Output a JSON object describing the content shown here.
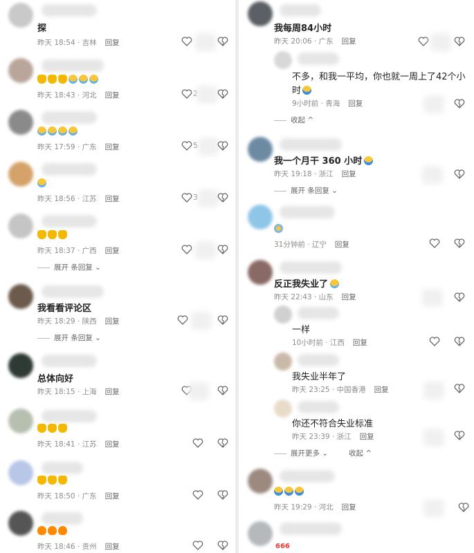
{
  "left": [
    {
      "text": "探",
      "emojis": [],
      "date": "昨天 18:54",
      "loc": "吉林",
      "reply": "回复",
      "likes": "",
      "av": "#c9c9c9"
    },
    {
      "text": "",
      "emojis": [
        "thumb",
        "thumb",
        "thumb",
        "cry",
        "cry",
        "cry"
      ],
      "date": "昨天 18:43",
      "loc": "河北",
      "reply": "回复",
      "likes": "2",
      "av": "#b9a59a"
    },
    {
      "text": "",
      "emojis": [
        "cry",
        "cry",
        "cry",
        "cry"
      ],
      "date": "昨天 17:59",
      "loc": "广东",
      "reply": "回复",
      "likes": "5",
      "av": "#8a8a8a"
    },
    {
      "text": "",
      "emojis": [
        "cry"
      ],
      "date": "昨天 18:56",
      "loc": "江苏",
      "reply": "回复",
      "likes": "3",
      "av": "#d5a36a"
    },
    {
      "text": "",
      "emojis": [
        "thumb",
        "thumb",
        "thumb"
      ],
      "date": "昨天 18:37",
      "loc": "广西",
      "reply": "回复",
      "likes": "",
      "av": "#c5c5c5",
      "expand": "展开 条回复"
    },
    {
      "text": "我看看评论区",
      "emojis": [],
      "date": "昨天 18:29",
      "loc": "陕西",
      "reply": "回复",
      "likes": "",
      "av": "#6c5a4c",
      "expand": "展开 条回复"
    },
    {
      "text": "总体向好",
      "emojis": [],
      "date": "昨天 18:15",
      "loc": "上海",
      "reply": "回复",
      "likes": "",
      "av": "#2e3a33"
    },
    {
      "text": "",
      "emojis": [
        "thumb",
        "thumb",
        "thumb"
      ],
      "date": "昨天 18:41",
      "loc": "江苏",
      "reply": "回复",
      "likes": "",
      "av": "#b7c0b0"
    },
    {
      "text": "",
      "emojis": [
        "thumb",
        "thumb",
        "thumb"
      ],
      "date": "昨天 18:50",
      "loc": "广东",
      "reply": "回复",
      "likes": "",
      "av": "#b8c6e8"
    },
    {
      "text": "",
      "emojis": [
        "fire",
        "fire",
        "fire"
      ],
      "date": "昨天 18:46",
      "loc": "贵州",
      "reply": "回复",
      "likes": "",
      "av": "#555555"
    }
  ],
  "right": {
    "c1": {
      "text": "我每周84小时",
      "date": "昨天 20:06",
      "loc": "广东",
      "reply": "回复",
      "av": "#5b5f66"
    },
    "c1r": {
      "text": "不多，和我一平均，你也就一周上了42个小",
      "text2": "时",
      "date": "9小时前",
      "loc": "青海",
      "reply": "回复",
      "av": "#d8d8d8"
    },
    "collapse1": "收起",
    "c2": {
      "text": "我一个月干 360 小时",
      "date": "昨天 19:18",
      "loc": "浙江",
      "reply": "回复",
      "av": "#6d8aa3",
      "expand": "展开 条回复"
    },
    "c3": {
      "text": "",
      "date": "31分钟前",
      "loc": "辽宁",
      "reply": "回复",
      "av": "#8fc6e8"
    },
    "c4": {
      "text": "反正我失业了",
      "date": "昨天 22:43",
      "loc": "山东",
      "reply": "回复",
      "av": "#8a6a66"
    },
    "c4r1": {
      "text": "一样",
      "date": "10小时前",
      "loc": "江西",
      "reply": "回复",
      "av": "#d0d0d0"
    },
    "c4r2": {
      "text": "我失业半年了",
      "date": "昨天 23:25",
      "loc": "中国香港",
      "reply": "回复",
      "av": "#c9b9a9"
    },
    "c4r3": {
      "text": "你还不符合失业标准",
      "date": "昨天 23:39",
      "loc": "浙江",
      "reply": "回复",
      "av": "#e8dcc9"
    },
    "expandMore": "展开更多",
    "collapse2": "收起",
    "c5": {
      "text": "",
      "date": "昨天 19:29",
      "loc": "河北",
      "reply": "回复",
      "av": "#9c8a80"
    },
    "c6": {
      "text": "666",
      "av": "#b5b9bc"
    }
  }
}
